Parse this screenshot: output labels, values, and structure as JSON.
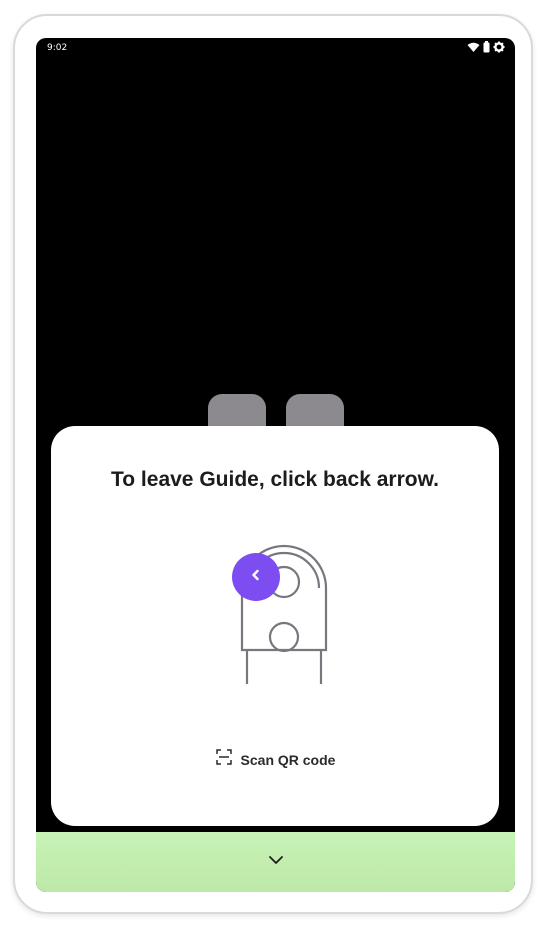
{
  "status_bar": {
    "time": "9:02",
    "icons": [
      "wifi-icon",
      "battery-icon",
      "settings-gear-icon"
    ]
  },
  "dialog": {
    "title": "To leave Guide, click back arrow.",
    "illustration": "robot-back-panel-icon",
    "back_button_icon": "chevron-left-icon",
    "scan_icon": "qr-scan-icon",
    "scan_label": "Scan QR code"
  },
  "bottom_bar": {
    "icon": "chevron-down-icon"
  },
  "colors": {
    "accent": "#7d4df2",
    "bottom_bar": "#c8f3b7",
    "screen_background": "#000000",
    "dialog_background": "#ffffff",
    "tab_shape": "#8d8a8f"
  }
}
